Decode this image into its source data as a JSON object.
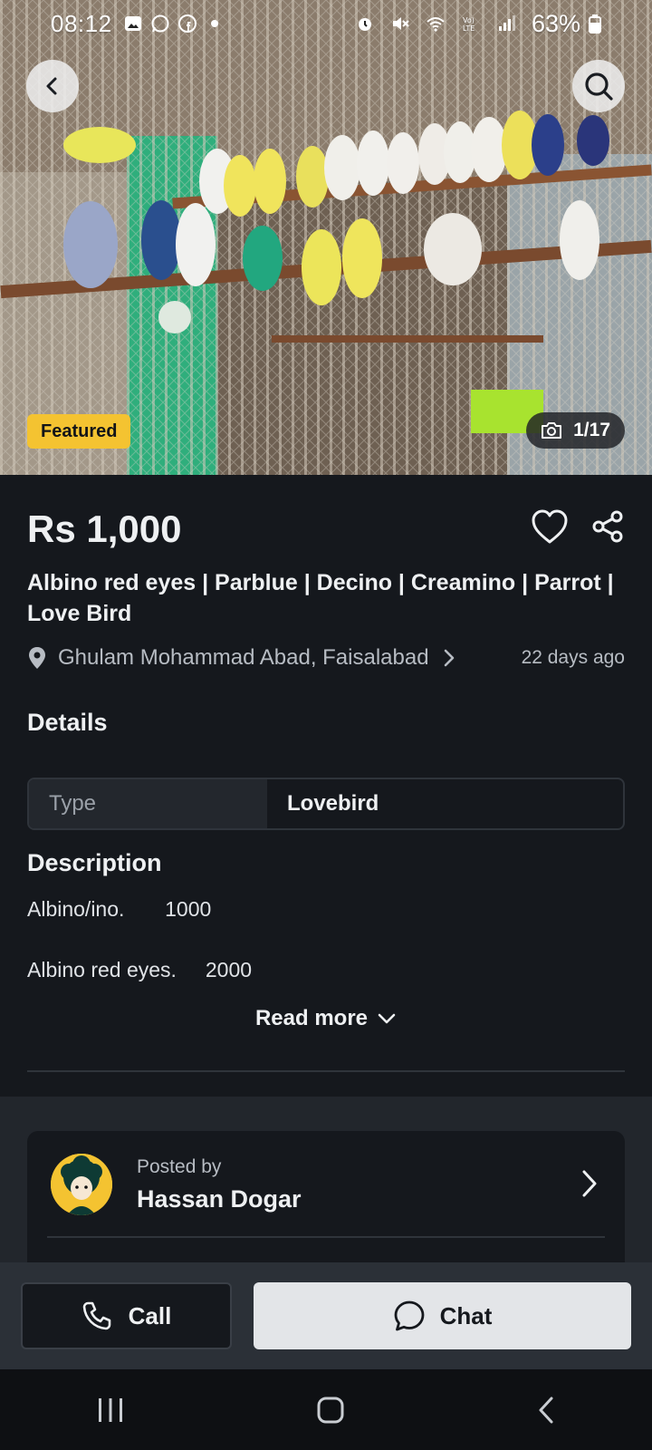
{
  "status_bar": {
    "time": "08:12",
    "battery": "63%"
  },
  "hero": {
    "badge": "Featured",
    "photo_counter": "1/17"
  },
  "listing": {
    "price": "Rs 1,000",
    "title": "Albino red eyes | Parblue | Decino | Creamino | Parrot | Love Bird",
    "location": "Ghulam Mohammad Abad, Faisalabad",
    "posted_ago": "22 days ago"
  },
  "details": {
    "heading": "Details",
    "rows": [
      {
        "key": "Type",
        "value": "Lovebird"
      }
    ]
  },
  "description": {
    "heading": "Description",
    "lines": [
      "Albino/ino.       1000",
      "Albino red eyes.     2000"
    ],
    "read_more": "Read more"
  },
  "poster": {
    "label": "Posted by",
    "name": "Hassan Dogar"
  },
  "actions": {
    "call": "Call",
    "chat": "Chat"
  },
  "colors": {
    "background": "#15181d",
    "featured_badge": "#f4c331",
    "chat_button": "#e3e5e8"
  }
}
